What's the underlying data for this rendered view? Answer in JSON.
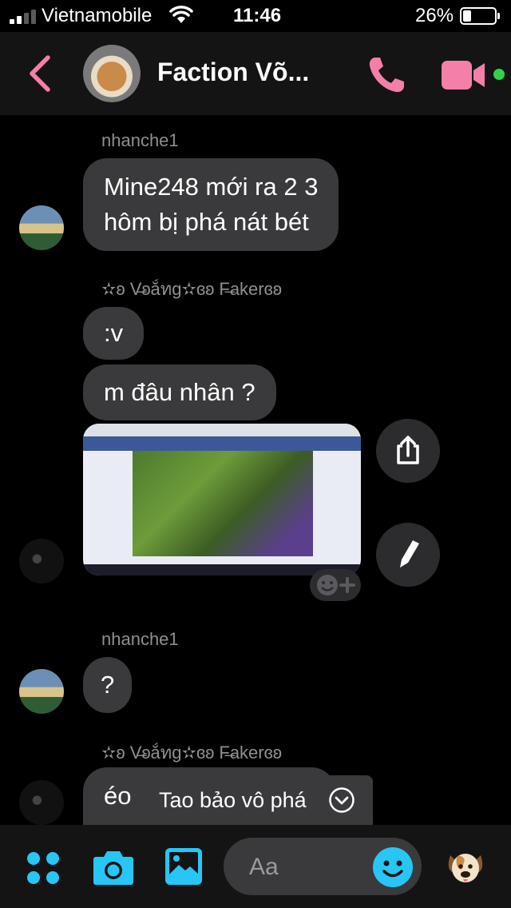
{
  "status_bar": {
    "carrier": "Vietnamobile",
    "time": "11:46",
    "battery_percent": "26%",
    "signal_bars": 2,
    "battery_level": 0.26
  },
  "header": {
    "title": "Faction Võ...",
    "back_icon": "chevron-left-icon",
    "call_icon": "phone-icon",
    "video_icon": "video-camera-icon",
    "accent_color": "#f47fa9",
    "active_status_color": "#2fd34a"
  },
  "messages": [
    {
      "sender": "nhanche1",
      "lines": [
        "Mine248 mới ra 2 3",
        "hôm bị phá nát bét"
      ]
    },
    {
      "sender": "✫ʚ V̶ʚắทg✫ɞʚ F̶akerɞʚ",
      "lines": [
        ":v"
      ]
    },
    {
      "lines": [
        "m đâu nhân ?"
      ]
    },
    {
      "sender": "nhanche1",
      "lines": [
        "?"
      ]
    },
    {
      "sender": "✫ʚ V̶ʚắทg✫ɞʚ F̶akerɞʚ",
      "lines": [
        "éo"
      ]
    }
  ],
  "attachment": {
    "type": "screenshot-image",
    "share_icon": "share-icon",
    "edit_icon": "pencil-icon",
    "reaction_icon": "add-reaction-icon"
  },
  "toast": {
    "text": "Tao bảo vô phá",
    "icon": "chevron-down-circle-icon"
  },
  "composer": {
    "placeholder": "Aa",
    "apps_icon": "four-dots-icon",
    "camera_icon": "camera-icon",
    "gallery_icon": "image-icon",
    "emoji_icon": "smiley-icon",
    "quick_reaction_icon": "dog-emoji-icon",
    "accent_color": "#27c6f5"
  }
}
